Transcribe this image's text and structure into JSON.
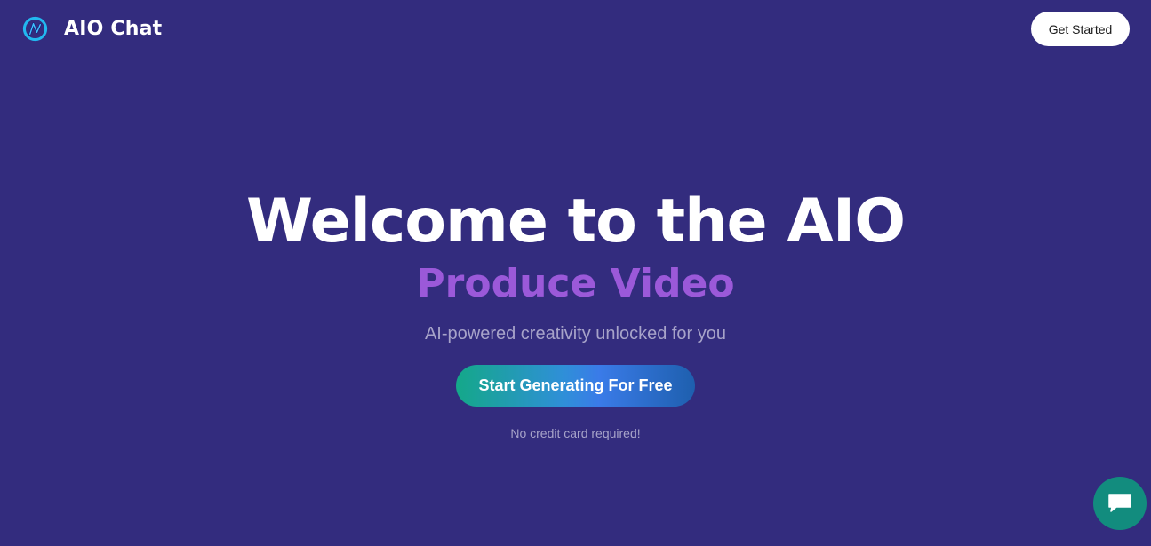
{
  "header": {
    "brand_name": "AIO Chat",
    "logo_icon": "aio-logo-icon",
    "get_started_label": "Get Started"
  },
  "hero": {
    "title": "Welcome to the AIO",
    "subtitle": "Produce Video",
    "tagline": "AI-powered creativity unlocked for you",
    "cta_label": "Start Generating For Free",
    "note": "No credit card required!"
  },
  "chat_widget": {
    "icon": "chat-bubble-icon"
  },
  "colors": {
    "background": "#332c7e",
    "accent_purple": "#9b59d9",
    "cta_gradient_start": "#14a889",
    "cta_gradient_mid": "#3a7be8",
    "cta_gradient_end": "#1e5fae",
    "chat_button": "#128c7e",
    "muted_text": "#a7a3c9"
  }
}
